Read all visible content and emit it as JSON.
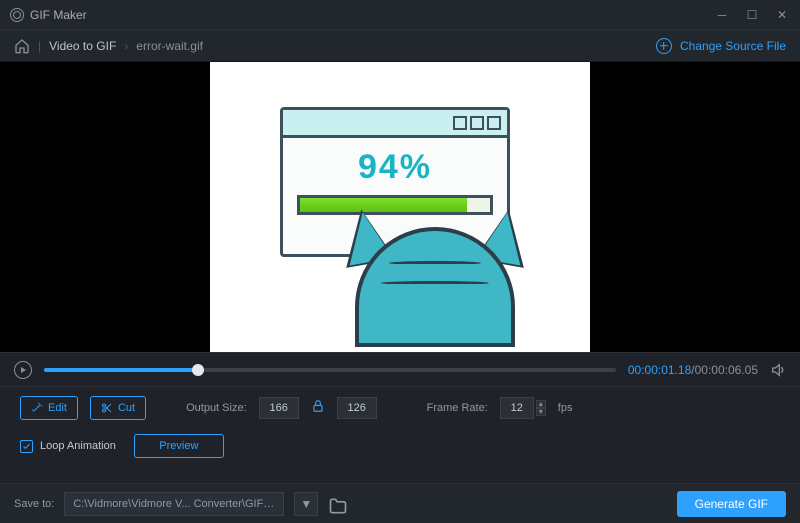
{
  "app": {
    "title": "GIF Maker"
  },
  "breadcrumb": {
    "root": "Video to GIF",
    "file": "error-wait.gif"
  },
  "header": {
    "change_source": "Change Source File"
  },
  "preview_content": {
    "percent_text": "94%",
    "progress_fraction": 0.94
  },
  "playback": {
    "current": "00:00:01.18",
    "total": "00:00:06.05"
  },
  "tools": {
    "edit": "Edit",
    "cut": "Cut",
    "output_size_label": "Output Size:",
    "width": "166",
    "height": "126",
    "frame_rate_label": "Frame Rate:",
    "frame_rate": "12",
    "fps": "fps"
  },
  "loop": {
    "label": "Loop Animation",
    "preview": "Preview",
    "checked": true
  },
  "footer": {
    "save_to_label": "Save to:",
    "path": "C:\\Vidmore\\Vidmore V... Converter\\GIF Maker",
    "generate": "Generate GIF"
  }
}
